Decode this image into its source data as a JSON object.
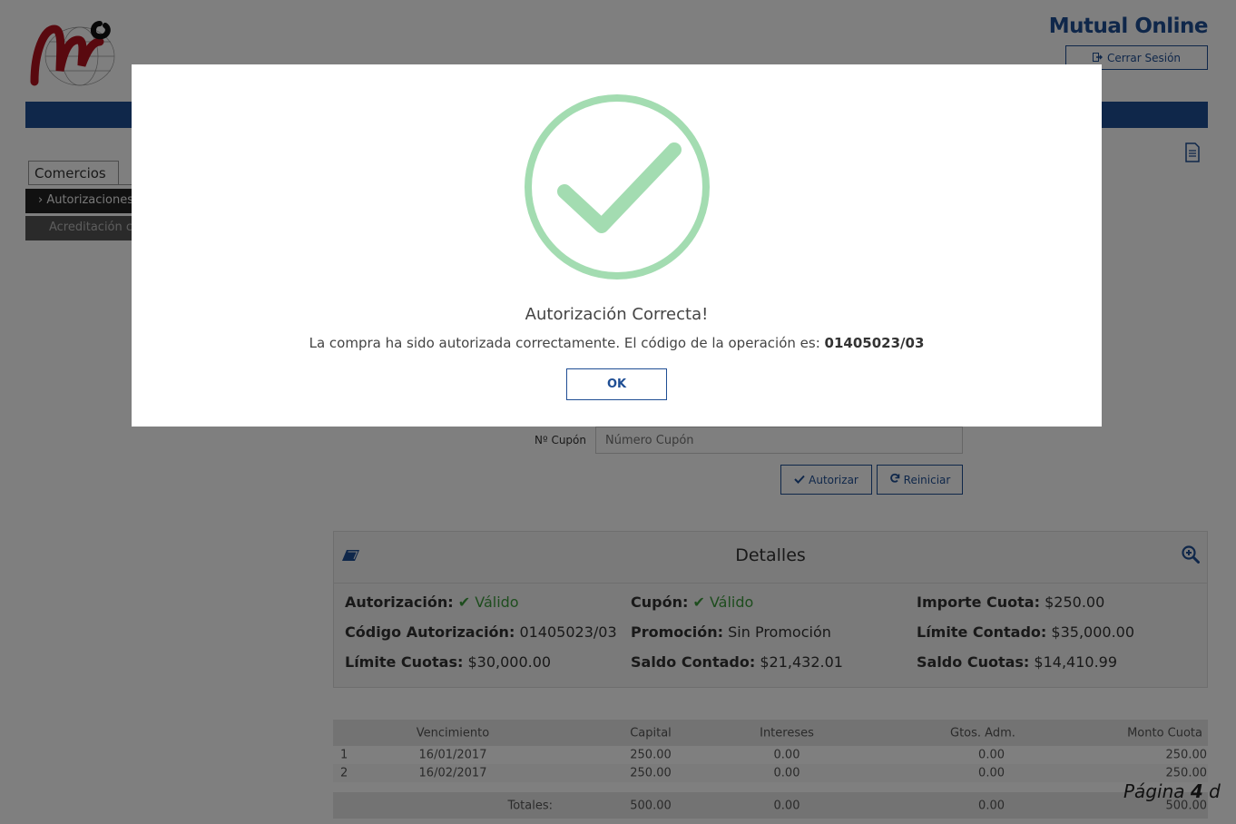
{
  "header": {
    "brand": "Mutual Online",
    "logout_label": "Cerrar Sesión",
    "colors": {
      "brand": "#1f4e94",
      "success": "#3c9a3c",
      "success_icon": "#a3dcb1"
    }
  },
  "sidebar": {
    "tab_label": "Comercios",
    "items": [
      {
        "label": "› Autorizaciones"
      },
      {
        "label": "Acreditación c"
      }
    ]
  },
  "form": {
    "coupon_label": "Nº Cupón",
    "coupon_placeholder": "Número Cupón",
    "authorize_label": "Autorizar",
    "reset_label": "Reiniciar"
  },
  "details": {
    "title": "Detalles",
    "fields": [
      {
        "label": "Autorización:",
        "value": "Válido",
        "status": "valid"
      },
      {
        "label": "Cupón:",
        "value": "Válido",
        "status": "valid"
      },
      {
        "label": "Importe Cuota:",
        "value": "$250.00"
      },
      {
        "label": "Código Autorización:",
        "value": "01405023/03"
      },
      {
        "label": "Promoción:",
        "value": "Sin Promoción"
      },
      {
        "label": "Límite Contado:",
        "value": "$35,000.00"
      },
      {
        "label": "Límite Cuotas:",
        "value": "$30,000.00"
      },
      {
        "label": "Saldo Contado:",
        "value": "$21,432.01"
      },
      {
        "label": "Saldo Cuotas:",
        "value": "$14,410.99"
      }
    ]
  },
  "installments": {
    "columns": [
      "Vencimiento",
      "Capital",
      "Intereses",
      "Gtos. Adm.",
      "Monto Cuota"
    ],
    "rows": [
      [
        "1",
        "16/01/2017",
        "250.00",
        "0.00",
        "0.00",
        "250.00"
      ],
      [
        "2",
        "16/02/2017",
        "250.00",
        "0.00",
        "0.00",
        "250.00"
      ]
    ],
    "totals": {
      "label": "Totales:",
      "capital": "500.00",
      "intereses": "0.00",
      "gastos": "0.00",
      "monto": "500.00"
    }
  },
  "modal": {
    "title": "Autorización Correcta!",
    "message": "La compra ha sido autorizada correctamente. El código de la operación es:",
    "code": "01405023/03",
    "ok_label": "OK"
  },
  "page_footer": {
    "prefix": "Página",
    "number": "4",
    "suffix": "d"
  }
}
